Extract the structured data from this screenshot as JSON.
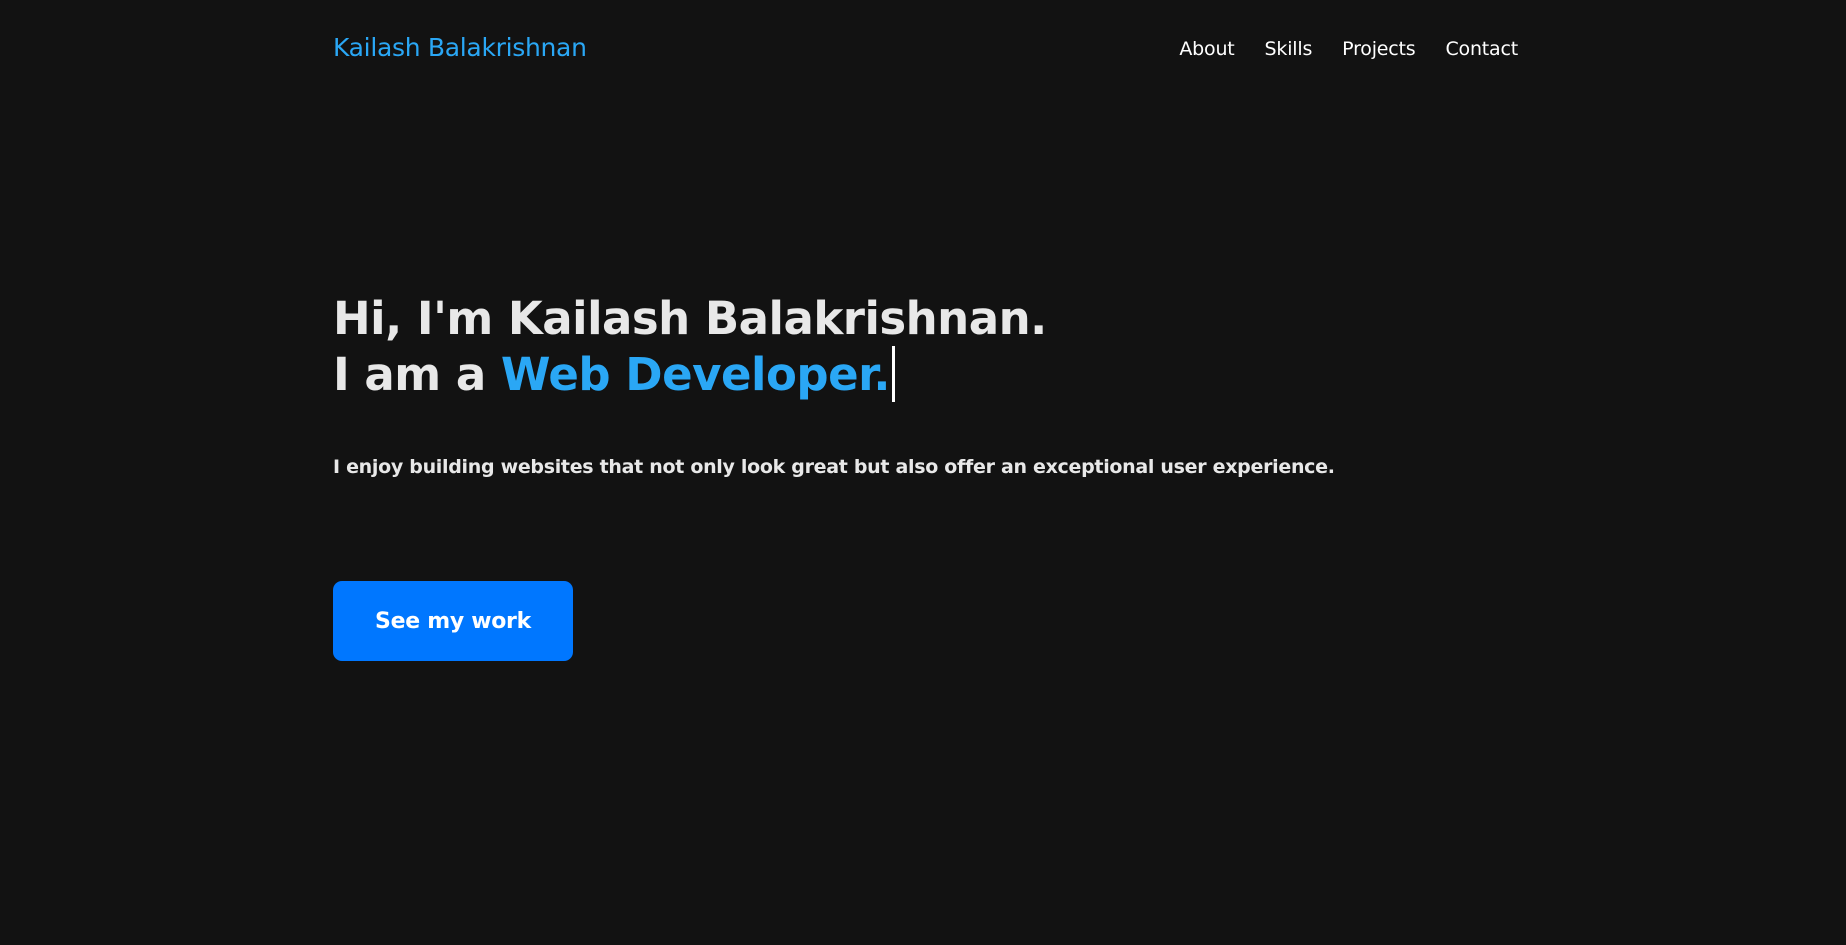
{
  "header": {
    "brand": "Kailash Balakrishnan",
    "nav": [
      {
        "label": "About"
      },
      {
        "label": "Skills"
      },
      {
        "label": "Projects"
      },
      {
        "label": "Contact"
      }
    ]
  },
  "hero": {
    "greeting": "Hi, I'm Kailash Balakrishnan.",
    "role_prefix": "I am a ",
    "role": "Web Developer.",
    "tagline": "I enjoy building websites that not only look great but also offer an exceptional user experience.",
    "cta_label": "See my work"
  },
  "colors": {
    "background": "#121212",
    "accent": "#2aa7f5",
    "button": "#0077ff",
    "text": "#e8e8e8"
  }
}
